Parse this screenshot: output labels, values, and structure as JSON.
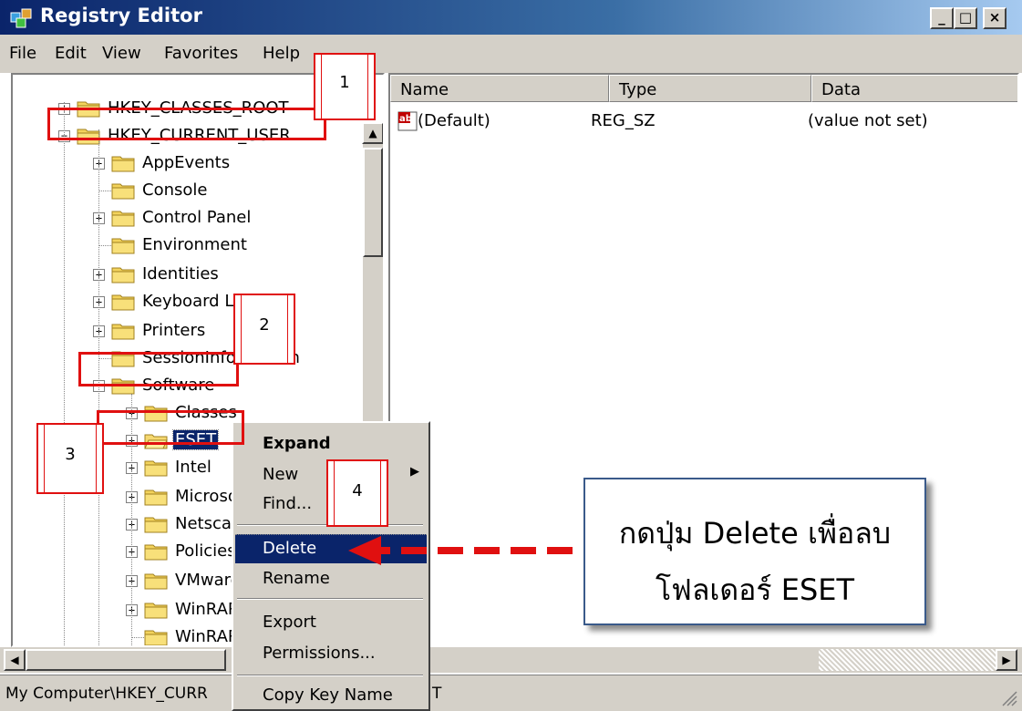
{
  "window": {
    "title": "Registry Editor",
    "controls": [
      "_",
      "□",
      "×"
    ]
  },
  "menu": [
    "File",
    "Edit",
    "View",
    "Favorites",
    "Help"
  ],
  "tree": {
    "nodes": [
      {
        "label": "HKEY_CLASSES_ROOT",
        "expander": "+"
      },
      {
        "label": "HKEY_CURRENT_USER",
        "expander": "−"
      },
      {
        "label": "AppEvents",
        "expander": "+"
      },
      {
        "label": "Console",
        "expander": ""
      },
      {
        "label": "Control Panel",
        "expander": "+"
      },
      {
        "label": "Environment",
        "expander": ""
      },
      {
        "label": "Identities",
        "expander": "+"
      },
      {
        "label": "Keyboard Layout",
        "expander": "+"
      },
      {
        "label": "Printers",
        "expander": "+"
      },
      {
        "label": "SessionInformation",
        "expander": ""
      },
      {
        "label": "Software",
        "expander": "−"
      },
      {
        "label": "Classes",
        "expander": "+"
      },
      {
        "label": "ESET",
        "expander": "+"
      },
      {
        "label": "Intel",
        "expander": "+"
      },
      {
        "label": "Microsoft",
        "expander": "+"
      },
      {
        "label": "Netscape",
        "expander": "+"
      },
      {
        "label": "Policies",
        "expander": "+"
      },
      {
        "label": "VMware",
        "expander": "+"
      },
      {
        "label": "WinRAR",
        "expander": "+"
      },
      {
        "label": "WinRAR",
        "expander": ""
      }
    ]
  },
  "list": {
    "columns": [
      "Name",
      "Type",
      "Data"
    ],
    "rows": [
      {
        "name": "(Default)",
        "type": "REG_SZ",
        "data": "(value not set)",
        "icon": "string-value-icon"
      }
    ]
  },
  "context_menu": {
    "items": [
      "Expand",
      "New",
      "Find...",
      "Delete",
      "Rename",
      "Export",
      "Permissions...",
      "Copy Key Name"
    ],
    "highlighted": "Delete"
  },
  "status": {
    "path_left": "My Computer\\HKEY_CURR",
    "path_right": "T"
  },
  "annotations": {
    "callout_numbers": [
      "1",
      "2",
      "3",
      "4"
    ],
    "callout_line1": "กดปุ่ม Delete เพื่อลบ",
    "callout_line2": "โฟลเดอร์ ESET",
    "arrow_color": "#e01010",
    "highlight_color": "#e01010"
  },
  "colors": {
    "titlebar": "#0a246a",
    "selection": "#0a246a",
    "chrome": "#d4d0c8"
  }
}
